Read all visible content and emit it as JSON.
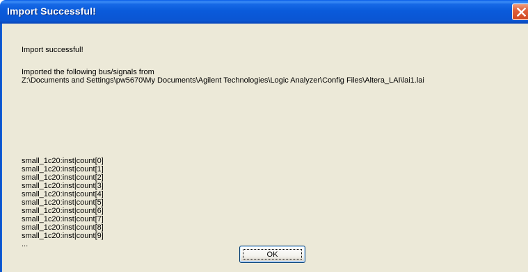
{
  "window": {
    "title": "Import Successful!"
  },
  "message": {
    "heading": "Import successful!",
    "intro": "Imported the following bus/signals from",
    "path": "Z:\\Documents and Settings\\pw5670\\My Documents\\Agilent Technologies\\Logic Analyzer\\Config Files\\Altera_LAI\\lai1.lai",
    "signals": [
      "small_1c20:inst|count[0]",
      "small_1c20:inst|count[1]",
      "small_1c20:inst|count[2]",
      "small_1c20:inst|count[3]",
      "small_1c20:inst|count[4]",
      "small_1c20:inst|count[5]",
      "small_1c20:inst|count[6]",
      "small_1c20:inst|count[7]",
      "small_1c20:inst|count[8]",
      "small_1c20:inst|count[9]"
    ],
    "ellipsis": "..."
  },
  "buttons": {
    "ok_label": "OK"
  },
  "icons": {
    "close": "close-icon"
  },
  "colors": {
    "titlebar": "#0a5bdb",
    "client_bg": "#ece9d8",
    "close_button": "#e0603c"
  }
}
